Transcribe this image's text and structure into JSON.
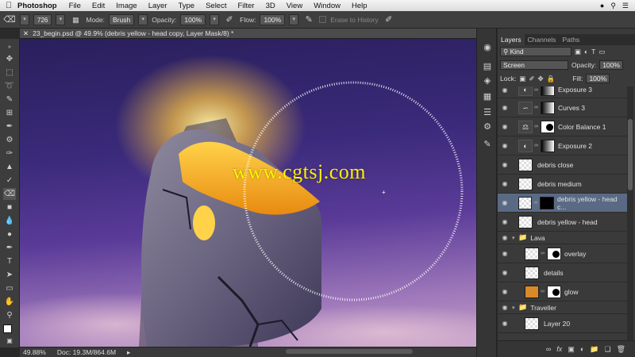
{
  "menubar": {
    "app_name": "Photoshop",
    "items": [
      "File",
      "Edit",
      "Image",
      "Layer",
      "Type",
      "Select",
      "Filter",
      "3D",
      "View",
      "Window",
      "Help"
    ]
  },
  "options": {
    "brush_size": "726",
    "mode_label": "Mode:",
    "mode_value": "Brush",
    "opacity_label": "Opacity:",
    "opacity_value": "100%",
    "flow_label": "Flow:",
    "flow_value": "100%",
    "erase_history_label": "Erase to History"
  },
  "document": {
    "tab_title": "23_begin.psd @ 49.9% (debris yellow - head copy, Layer Mask/8) *",
    "zoom": "49.88%",
    "doc_size": "Doc: 19.3M/864.6M",
    "watermark": "www.cgtsj.com"
  },
  "panel": {
    "tabs": [
      "Layers",
      "Channels",
      "Paths"
    ],
    "filter_label": "Kind",
    "blend_mode": "Screen",
    "opacity_label": "Opacity:",
    "opacity_value": "100%",
    "lock_label": "Lock:",
    "fill_label": "Fill:",
    "fill_value": "100%"
  },
  "layers": [
    {
      "name": "Exposure 3",
      "kind": "adjustment",
      "icon": "exposure"
    },
    {
      "name": "Curves 3",
      "kind": "adjustment",
      "icon": "curves"
    },
    {
      "name": "Color Balance 1",
      "kind": "adjustment",
      "icon": "balance"
    },
    {
      "name": "Exposure 2",
      "kind": "adjustment",
      "icon": "exposure"
    },
    {
      "name": "debris close",
      "kind": "pixel"
    },
    {
      "name": "debris medium",
      "kind": "pixel"
    },
    {
      "name": "debris yellow - head c...",
      "kind": "masked",
      "selected": true
    },
    {
      "name": "debris yellow - head",
      "kind": "pixel"
    },
    {
      "name": "Lava",
      "kind": "group"
    },
    {
      "name": "overlay",
      "kind": "masked"
    },
    {
      "name": "details",
      "kind": "pixel"
    },
    {
      "name": "glow",
      "kind": "masked-color"
    },
    {
      "name": "Traveller",
      "kind": "group"
    },
    {
      "name": "Layer 20",
      "kind": "pixel"
    }
  ],
  "colors": {
    "watermark": "#fff200",
    "selected_layer": "#5a6a85",
    "lava": "#f5a20a"
  }
}
